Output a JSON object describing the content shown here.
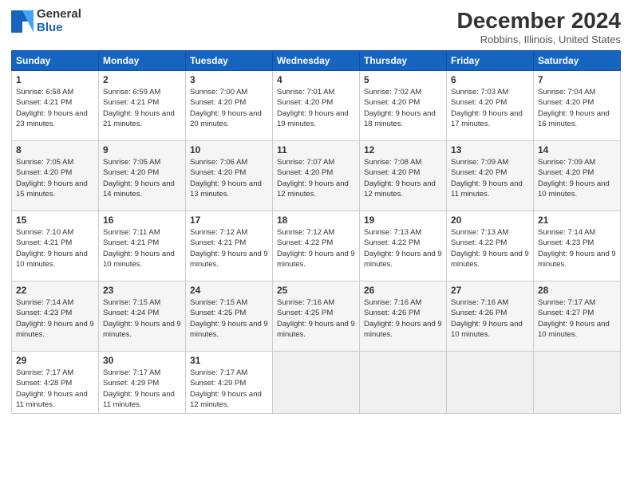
{
  "header": {
    "logo_general": "General",
    "logo_blue": "Blue",
    "month_title": "December 2024",
    "location": "Robbins, Illinois, United States"
  },
  "weekdays": [
    "Sunday",
    "Monday",
    "Tuesday",
    "Wednesday",
    "Thursday",
    "Friday",
    "Saturday"
  ],
  "weeks": [
    [
      {
        "day": "1",
        "sunrise": "6:58 AM",
        "sunset": "4:21 PM",
        "daylight": "9 hours and 23 minutes."
      },
      {
        "day": "2",
        "sunrise": "6:59 AM",
        "sunset": "4:21 PM",
        "daylight": "9 hours and 21 minutes."
      },
      {
        "day": "3",
        "sunrise": "7:00 AM",
        "sunset": "4:20 PM",
        "daylight": "9 hours and 20 minutes."
      },
      {
        "day": "4",
        "sunrise": "7:01 AM",
        "sunset": "4:20 PM",
        "daylight": "9 hours and 19 minutes."
      },
      {
        "day": "5",
        "sunrise": "7:02 AM",
        "sunset": "4:20 PM",
        "daylight": "9 hours and 18 minutes."
      },
      {
        "day": "6",
        "sunrise": "7:03 AM",
        "sunset": "4:20 PM",
        "daylight": "9 hours and 17 minutes."
      },
      {
        "day": "7",
        "sunrise": "7:04 AM",
        "sunset": "4:20 PM",
        "daylight": "9 hours and 16 minutes."
      }
    ],
    [
      {
        "day": "8",
        "sunrise": "7:05 AM",
        "sunset": "4:20 PM",
        "daylight": "9 hours and 15 minutes."
      },
      {
        "day": "9",
        "sunrise": "7:05 AM",
        "sunset": "4:20 PM",
        "daylight": "9 hours and 14 minutes."
      },
      {
        "day": "10",
        "sunrise": "7:06 AM",
        "sunset": "4:20 PM",
        "daylight": "9 hours and 13 minutes."
      },
      {
        "day": "11",
        "sunrise": "7:07 AM",
        "sunset": "4:20 PM",
        "daylight": "9 hours and 12 minutes."
      },
      {
        "day": "12",
        "sunrise": "7:08 AM",
        "sunset": "4:20 PM",
        "daylight": "9 hours and 12 minutes."
      },
      {
        "day": "13",
        "sunrise": "7:09 AM",
        "sunset": "4:20 PM",
        "daylight": "9 hours and 11 minutes."
      },
      {
        "day": "14",
        "sunrise": "7:09 AM",
        "sunset": "4:20 PM",
        "daylight": "9 hours and 10 minutes."
      }
    ],
    [
      {
        "day": "15",
        "sunrise": "7:10 AM",
        "sunset": "4:21 PM",
        "daylight": "9 hours and 10 minutes."
      },
      {
        "day": "16",
        "sunrise": "7:11 AM",
        "sunset": "4:21 PM",
        "daylight": "9 hours and 10 minutes."
      },
      {
        "day": "17",
        "sunrise": "7:12 AM",
        "sunset": "4:21 PM",
        "daylight": "9 hours and 9 minutes."
      },
      {
        "day": "18",
        "sunrise": "7:12 AM",
        "sunset": "4:22 PM",
        "daylight": "9 hours and 9 minutes."
      },
      {
        "day": "19",
        "sunrise": "7:13 AM",
        "sunset": "4:22 PM",
        "daylight": "9 hours and 9 minutes."
      },
      {
        "day": "20",
        "sunrise": "7:13 AM",
        "sunset": "4:22 PM",
        "daylight": "9 hours and 9 minutes."
      },
      {
        "day": "21",
        "sunrise": "7:14 AM",
        "sunset": "4:23 PM",
        "daylight": "9 hours and 9 minutes."
      }
    ],
    [
      {
        "day": "22",
        "sunrise": "7:14 AM",
        "sunset": "4:23 PM",
        "daylight": "9 hours and 9 minutes."
      },
      {
        "day": "23",
        "sunrise": "7:15 AM",
        "sunset": "4:24 PM",
        "daylight": "9 hours and 9 minutes."
      },
      {
        "day": "24",
        "sunrise": "7:15 AM",
        "sunset": "4:25 PM",
        "daylight": "9 hours and 9 minutes."
      },
      {
        "day": "25",
        "sunrise": "7:16 AM",
        "sunset": "4:25 PM",
        "daylight": "9 hours and 9 minutes."
      },
      {
        "day": "26",
        "sunrise": "7:16 AM",
        "sunset": "4:26 PM",
        "daylight": "9 hours and 9 minutes."
      },
      {
        "day": "27",
        "sunrise": "7:16 AM",
        "sunset": "4:26 PM",
        "daylight": "9 hours and 10 minutes."
      },
      {
        "day": "28",
        "sunrise": "7:17 AM",
        "sunset": "4:27 PM",
        "daylight": "9 hours and 10 minutes."
      }
    ],
    [
      {
        "day": "29",
        "sunrise": "7:17 AM",
        "sunset": "4:28 PM",
        "daylight": "9 hours and 11 minutes."
      },
      {
        "day": "30",
        "sunrise": "7:17 AM",
        "sunset": "4:29 PM",
        "daylight": "9 hours and 11 minutes."
      },
      {
        "day": "31",
        "sunrise": "7:17 AM",
        "sunset": "4:29 PM",
        "daylight": "9 hours and 12 minutes."
      },
      null,
      null,
      null,
      null
    ]
  ],
  "labels": {
    "sunrise_prefix": "Sunrise: ",
    "sunset_prefix": "Sunset: ",
    "daylight_prefix": "Daylight: "
  }
}
